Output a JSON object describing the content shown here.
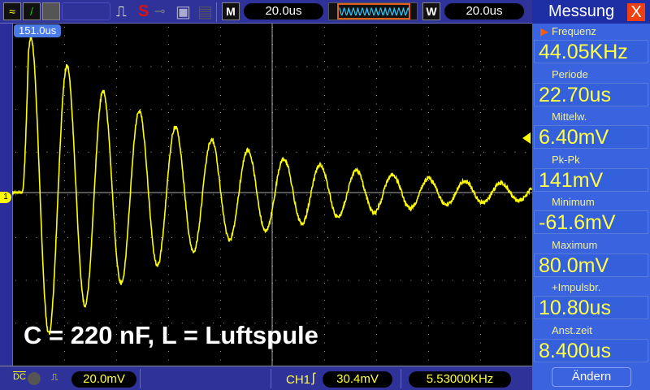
{
  "toolbar": {
    "timebase": "20.0us",
    "window_timebase": "20.0us",
    "m_label": "M",
    "w_label": "W",
    "s_label": "S"
  },
  "screen": {
    "cursor_time": "151.0us",
    "annotation": "C = 220 nF, L = Luftspule",
    "channel_marker": "1"
  },
  "status": {
    "coupling": "DC",
    "ch_scale": "20.0mV",
    "trigger_source": "CH1",
    "trigger_level": "30.4mV",
    "trigger_freq": "5.53000KHz"
  },
  "panel": {
    "title": "Messung",
    "close": "X",
    "measurements": [
      {
        "label": "Frequenz",
        "value": "44.05KHz"
      },
      {
        "label": "Periode",
        "value": "22.70us"
      },
      {
        "label": "Mittelw.",
        "value": "6.40mV"
      },
      {
        "label": "Pk-Pk",
        "value": "141mV"
      },
      {
        "label": "Minimum",
        "value": "-61.6mV"
      },
      {
        "label": "Maximum",
        "value": "80.0mV"
      },
      {
        "label": "+Impulsbr.",
        "value": "10.80us"
      },
      {
        "label": "Anst.zeit",
        "value": "8.400us"
      }
    ],
    "change_button": "Ändern"
  },
  "colors": {
    "trace": "#ffff00",
    "panel": "#3a63e0",
    "toolbar": "#2f3299"
  }
}
